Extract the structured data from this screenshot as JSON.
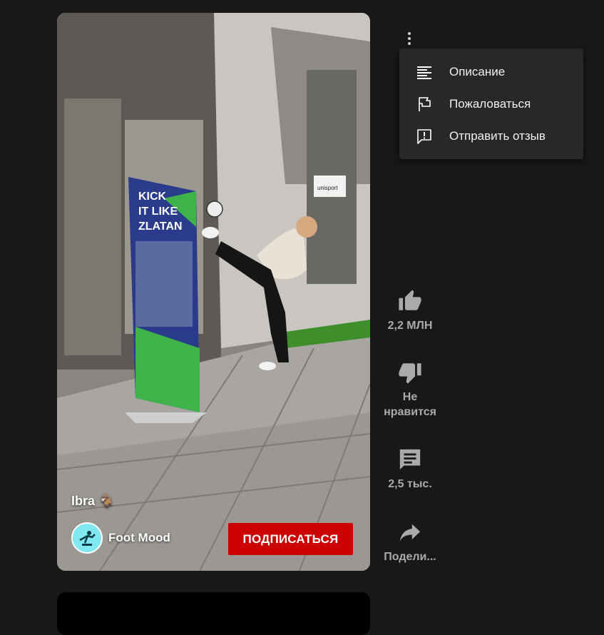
{
  "video": {
    "caption": "Ibra 🐐",
    "channel_name": "Foot Mood",
    "subscribe_label": "ПОДПИСАТЬСЯ",
    "sign_text": [
      "KICK",
      "IT LIKE",
      "ZLATAN"
    ],
    "store_text": "unisport"
  },
  "menu": {
    "items": [
      {
        "label": "Описание",
        "icon": "description-icon"
      },
      {
        "label": "Пожаловаться",
        "icon": "flag-icon"
      },
      {
        "label": "Отправить отзыв",
        "icon": "feedback-icon"
      }
    ]
  },
  "actions": {
    "like_count": "2,2 МЛН",
    "dislike_label": "Не нравится",
    "comment_count": "2,5 тыс.",
    "share_label": "Подели..."
  },
  "colors": {
    "background": "#181818",
    "menu_bg": "#282828",
    "subscribe": "#cc0000",
    "action_text": "#aaaaaa"
  }
}
